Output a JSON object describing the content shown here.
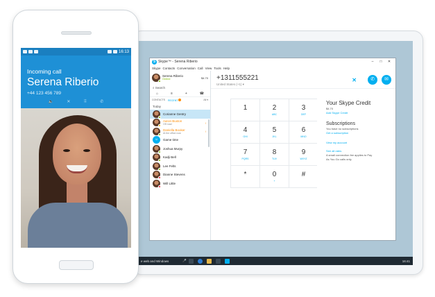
{
  "phone": {
    "status_time": "16:13",
    "incoming_label": "Incoming call",
    "caller_name": "Serena Riberio",
    "caller_number": "+44 123 456 789",
    "controls": [
      "🔈",
      "✕",
      "⠿",
      "✆"
    ]
  },
  "skype": {
    "window_title": "Skype™ - Serena Riberio",
    "window_controls": [
      "–",
      "□",
      "✕"
    ],
    "menu": [
      "Skype",
      "Contacts",
      "Conversation",
      "Call",
      "View",
      "Tools",
      "Help"
    ],
    "profile": {
      "name": "Serena Riberio",
      "status": "Online",
      "credit": "$4.70"
    },
    "search_label": "Search",
    "nav_icons": [
      "⌂",
      "≡",
      "+",
      "☎"
    ],
    "tabs": {
      "contacts": "CONTACTS",
      "recent": "RECENT",
      "more": "All ▾"
    },
    "section_label": "Today",
    "contacts": [
      {
        "name": "Corianne Gentry",
        "sub": "",
        "presence": "online",
        "selected": true,
        "alert": false,
        "flag": ""
      },
      {
        "name": "Aaron Buxton",
        "sub": "Off road",
        "presence": "away",
        "selected": false,
        "alert": true,
        "flag": "!"
      },
      {
        "name": "Daniella Booker",
        "sub": "At the office now",
        "presence": "online",
        "selected": false,
        "alert": true,
        "flag": "!"
      },
      {
        "name": "Game time",
        "sub": "",
        "presence": "group",
        "selected": false,
        "alert": false,
        "flag": ""
      },
      {
        "name": "Joshua Murpy",
        "sub": "",
        "presence": "online",
        "selected": false,
        "alert": false,
        "flag": ""
      },
      {
        "name": "Kadji Bell",
        "sub": "",
        "presence": "online",
        "selected": false,
        "alert": false,
        "flag": ""
      },
      {
        "name": "Lee Felts",
        "sub": "",
        "presence": "online",
        "selected": false,
        "alert": false,
        "flag": ""
      },
      {
        "name": "Dianne Stevens",
        "sub": "",
        "presence": "dnd",
        "selected": false,
        "alert": false,
        "flag": ""
      },
      {
        "name": "Will Little",
        "sub": "",
        "presence": "dnd",
        "selected": false,
        "alert": false,
        "flag": ""
      }
    ],
    "dialed_number": "+1311555221",
    "country": "United States (+1) ▾",
    "clear_icon_label": "✕",
    "call_button_label": "✆",
    "message_button_label": "✉",
    "keypad": [
      {
        "digit": "1",
        "letters": ""
      },
      {
        "digit": "2",
        "letters": "ABC"
      },
      {
        "digit": "3",
        "letters": "DEF"
      },
      {
        "digit": "4",
        "letters": "GHI"
      },
      {
        "digit": "5",
        "letters": "JKL"
      },
      {
        "digit": "6",
        "letters": "MNO"
      },
      {
        "digit": "7",
        "letters": "PQRS"
      },
      {
        "digit": "8",
        "letters": "TUV"
      },
      {
        "digit": "9",
        "letters": "WXYZ"
      },
      {
        "digit": "*",
        "letters": ""
      },
      {
        "digit": "0",
        "letters": "+"
      },
      {
        "digit": "#",
        "letters": ""
      }
    ],
    "credit": {
      "title": "Your Skype Credit",
      "amount": "$4.70",
      "add_link": "Add Skype Credit",
      "subs_title": "Subscriptions",
      "subs_none": "You have no subscriptions",
      "subs_link": "Get a subscription",
      "account_link": "View my account",
      "rates_link": "See all rates",
      "fee_note_1": "A small connection fee applies to Pay",
      "fee_note_2": "As You Go calls only."
    }
  },
  "taskbar": {
    "search_text": "e web and Windows",
    "mic_icon": "🎤",
    "clock": "16:41"
  },
  "colors": {
    "skype_blue": "#00aff0",
    "phone_blue": "#1e90d6",
    "online": "#7fba00",
    "away": "#ffb900",
    "dnd": "#e81123"
  }
}
